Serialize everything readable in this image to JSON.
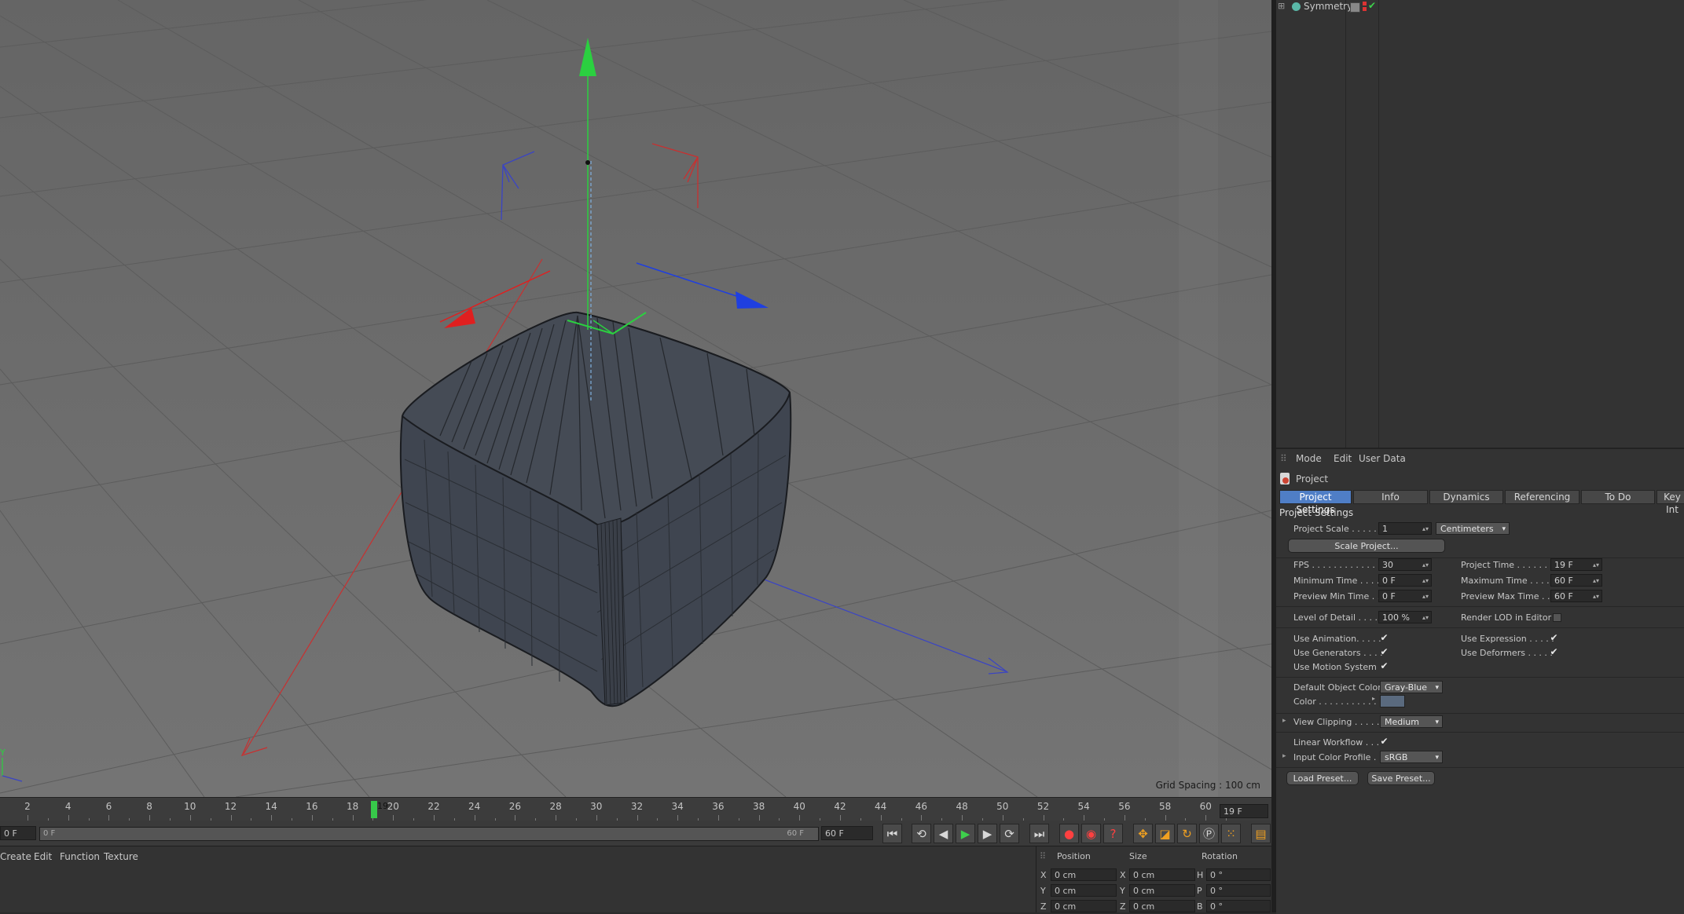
{
  "viewport": {
    "grid_spacing": "Grid Spacing : 100 cm",
    "axis_y_label": "Y"
  },
  "timeline": {
    "ticks": [
      "2",
      "4",
      "6",
      "8",
      "10",
      "12",
      "14",
      "16",
      "18",
      "20",
      "22",
      "24",
      "26",
      "28",
      "30",
      "32",
      "34",
      "36",
      "38",
      "40",
      "42",
      "44",
      "46",
      "48",
      "50",
      "52",
      "54",
      "56",
      "58",
      "60"
    ],
    "current_frame_marker": "19",
    "current_frame_box": "19 F"
  },
  "transport": {
    "start_field": "0 F",
    "range_start": "0 F",
    "range_end": "60 F",
    "end_field": "60 F"
  },
  "material_menu": [
    "Create",
    "Edit",
    "Function",
    "Texture"
  ],
  "coordinates": {
    "headers": [
      "Position",
      "Size",
      "Rotation"
    ],
    "rows": [
      {
        "axis": "X",
        "pos": "0 cm",
        "size_axis": "X",
        "size": "0 cm",
        "rot_axis": "H",
        "rot": "0 °"
      },
      {
        "axis": "Y",
        "pos": "0 cm",
        "size_axis": "Y",
        "size": "0 cm",
        "rot_axis": "P",
        "rot": "0 °"
      },
      {
        "axis": "Z",
        "pos": "0 cm",
        "size_axis": "Z",
        "size": "0 cm",
        "rot_axis": "B",
        "rot": "0 °"
      }
    ]
  },
  "object_manager": {
    "items": [
      {
        "name": "Symmetry"
      }
    ]
  },
  "attributes": {
    "menu": [
      "Mode",
      "Edit",
      "User Data"
    ],
    "object_title": "Project",
    "tabs": [
      "Project Settings",
      "Info",
      "Dynamics",
      "Referencing",
      "To Do",
      "Key Int"
    ],
    "section_title": "Project Settings",
    "project_scale_label": "Project Scale . . . . . .",
    "project_scale_value": "1",
    "project_scale_unit": "Centimeters",
    "scale_project_btn": "Scale Project...",
    "fps_label": "FPS . . . . . . . . . . . . . .",
    "fps_value": "30",
    "project_time_label": "Project Time . . . . . . .",
    "project_time_value": "19 F",
    "min_time_label": "Minimum Time . . . .",
    "min_time_value": "0 F",
    "max_time_label": "Maximum Time . . . .",
    "max_time_value": "60 F",
    "prev_min_label": "Preview Min Time . .",
    "prev_min_value": "0 F",
    "prev_max_label": "Preview Max Time . . .",
    "prev_max_value": "60 F",
    "lod_label": "Level of Detail . . . . .",
    "lod_value": "100 %",
    "render_lod_label": "Render LOD in Editor",
    "use_animation_label": "Use Animation. . . . .",
    "use_expression_label": "Use Expression . . . . .",
    "use_generators_label": "Use Generators . . . .",
    "use_deformers_label": "Use Deformers . . . . .",
    "use_motion_label": "Use Motion System",
    "default_color_label": "Default Object Color",
    "default_color_value": "Gray-Blue",
    "color_label": "Color . . . . . . . . . . . .",
    "color_swatch": "#5a6a7e",
    "view_clipping_label": "View Clipping . . . . . .",
    "view_clipping_value": "Medium",
    "linear_workflow_label": "Linear Workflow . . .",
    "input_profile_label": "Input Color Profile . .",
    "input_profile_value": "sRGB",
    "load_preset_btn": "Load Preset...",
    "save_preset_btn": "Save Preset..."
  },
  "colors": {
    "accent": "#4f7ec6",
    "axis_x": "#e01f1f",
    "axis_y": "#21c43a",
    "axis_z": "#1f3fe0"
  }
}
